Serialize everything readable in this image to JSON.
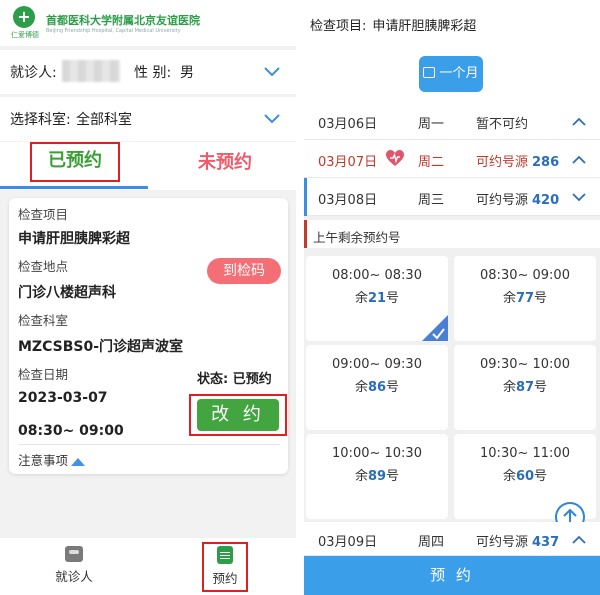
{
  "left": {
    "hospital": {
      "name": "首都医科大学附属北京友谊医院",
      "name_en": "Beijing Friendship Hospital, Capital Medical University",
      "logo_text": "仁爱博德"
    },
    "patient": {
      "label": "就诊人:",
      "gender_label": "性 别:",
      "gender_value": "男"
    },
    "department": {
      "label": "选择科室:",
      "value": "全部科室"
    },
    "tabs": {
      "booked": "已预约",
      "unbooked": "未预约"
    },
    "card": {
      "item_label": "检查项目",
      "item_value": "申请肝胆胰脾彩超",
      "location_label": "检查地点",
      "location_value": "门诊八楼超声科",
      "checkin_button": "到检码",
      "room_label": "检查科室",
      "room_value": "MZCSBS0-门诊超声波室",
      "date_label": "检查日期",
      "status": "状态: 已预约",
      "date_value": "2023-03-07",
      "time_value": "08:30~ 09:00",
      "change_button": "改 约",
      "notice": "注意事项"
    },
    "nav": {
      "patient": "就诊人",
      "booking": "预约"
    }
  },
  "right": {
    "header": {
      "label": "检查项目:",
      "value": "申请肝胆胰脾彩超"
    },
    "month_button": "一个月",
    "dates": [
      {
        "date": "03月06日",
        "weekday": "周一",
        "status": "暂不可约",
        "count": ""
      },
      {
        "date": "03月07日",
        "weekday": "周二",
        "status": "可约号源",
        "count": "286"
      },
      {
        "date": "03月08日",
        "weekday": "周三",
        "status": "可约号源",
        "count": "420"
      },
      {
        "date": "03月09日",
        "weekday": "周四",
        "status": "可约号源",
        "count": "437"
      }
    ],
    "am_label": "上午剩余预约号",
    "slots": [
      {
        "time": "08:00~ 08:30",
        "pre": "余",
        "count": "21",
        "post": "号"
      },
      {
        "time": "08:30~ 09:00",
        "pre": "余",
        "count": "77",
        "post": "号"
      },
      {
        "time": "09:00~ 09:30",
        "pre": "余",
        "count": "86",
        "post": "号"
      },
      {
        "time": "09:30~ 10:00",
        "pre": "余",
        "count": "87",
        "post": "号"
      },
      {
        "time": "10:00~ 10:30",
        "pre": "余",
        "count": "89",
        "post": "号"
      },
      {
        "time": "10:30~ 11:00",
        "pre": "余",
        "count": "60",
        "post": "号"
      }
    ],
    "book_button": "预 约"
  },
  "colors": {
    "green": "#3aa035",
    "red_box": "#e02020",
    "blue": "#3a9ee8",
    "pink": "#f36f75"
  }
}
